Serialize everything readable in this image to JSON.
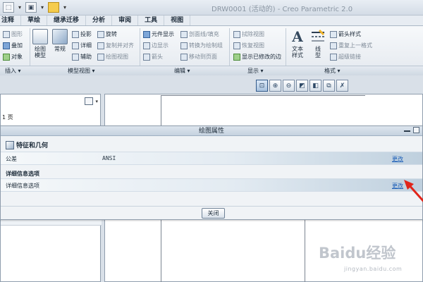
{
  "title_bar": {
    "title": "DRW0001 (活动的) - Creo Parametric 2.0",
    "quick_access_icons": [
      "frame-select-icon",
      "window-icon",
      "folder-icon"
    ]
  },
  "tabs": [
    "注释",
    "草绘",
    "继承迁移",
    "分析",
    "审阅",
    "工具",
    "视图"
  ],
  "ribbon": {
    "insert_group": {
      "items": [
        "图形",
        "叠加",
        "对象"
      ],
      "label": "插入 ▾"
    },
    "model_views_group": {
      "big_buttons": [
        "绘图模型",
        "常规"
      ],
      "items": [
        "投影",
        "详细",
        "辅助",
        "旋转",
        "复制并对齐",
        "绘图视图"
      ],
      "label": "模型视图 ▾"
    },
    "edit_group": {
      "items": [
        "元件显示",
        "边显示",
        "箭头",
        "剖面线/填充",
        "转换为绘制组",
        "移动到页面"
      ],
      "label": "编辑 ▾"
    },
    "display_group": {
      "items": [
        "拭除视图",
        "恢复视图",
        "显示已修改的边"
      ],
      "label": "显示 ▾"
    },
    "format_group": {
      "big_buttons": [
        "文本样式",
        "线型"
      ],
      "items": [
        "箭头样式",
        "重复上一格式",
        "超级链接"
      ],
      "label": "格式 ▾"
    }
  },
  "graphics_toolbar": [
    "refit-icon",
    "zoom-in-icon",
    "zoom-out-icon",
    "repaint-icon",
    "display-style-icon",
    "view-manager-icon",
    "datum-display-icon"
  ],
  "left_panel": {
    "page_label": "1 页"
  },
  "dialog": {
    "title": "绘图属性",
    "section1_title": "特征和几何",
    "row1": {
      "label": "公差",
      "value": "ANSI",
      "action": "更改"
    },
    "section2_title": "详细信息选项",
    "row2": {
      "label": "详细信息选项",
      "action": "更改"
    },
    "close_label": "关闭"
  },
  "watermark": {
    "brand": "Baidu经验",
    "url": "jingyan.baidu.com"
  },
  "colors": {
    "link": "#1d5fb8",
    "arrow": "#e0251b"
  }
}
